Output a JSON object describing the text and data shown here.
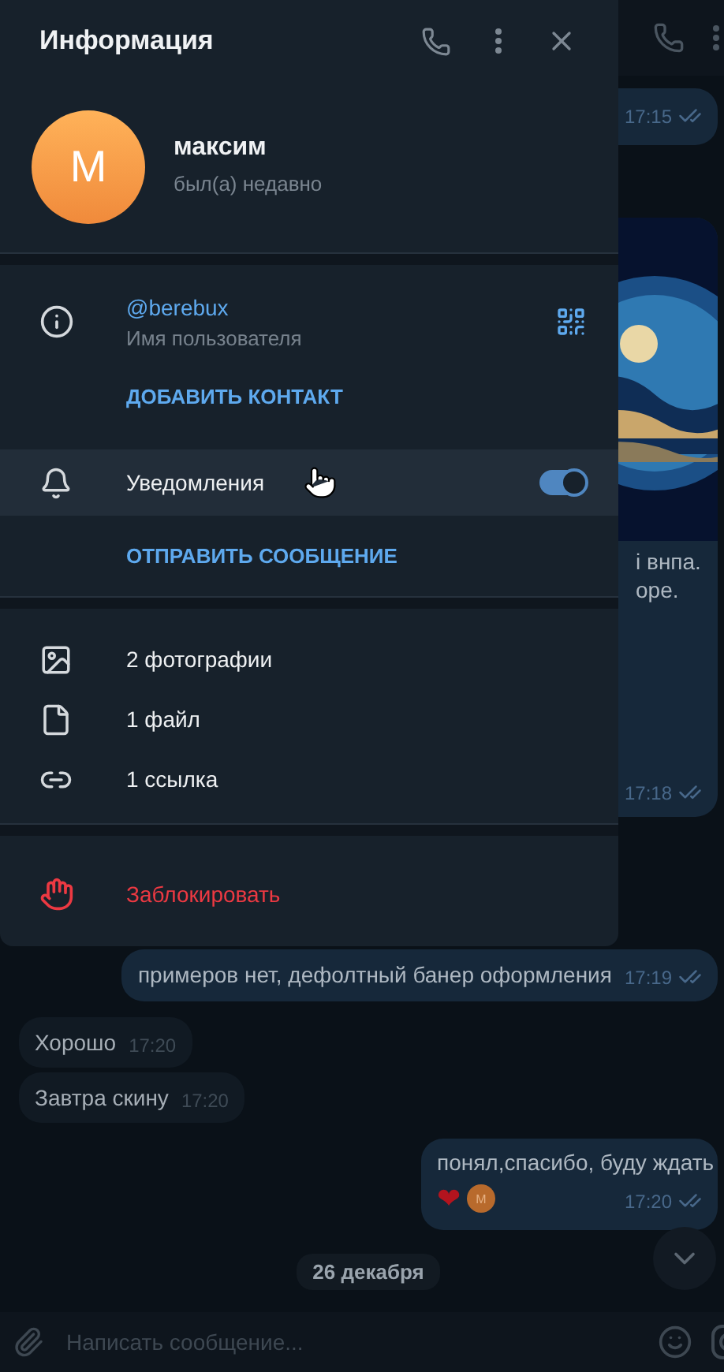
{
  "chat": {
    "messages": [
      {
        "outgoing": true,
        "kind": "text",
        "time": "17:15",
        "read": true
      },
      {
        "outgoing": true,
        "lines": [
          "і внпа.",
          "оре."
        ],
        "time": "17:18",
        "read": true
      },
      {
        "outgoing": true,
        "kind": "text",
        "text": "примеров нет, дефолтный банер оформления",
        "time": "17:19",
        "read": true
      },
      {
        "outgoing": false,
        "kind": "text",
        "text": "Хорошо",
        "time": "17:20"
      },
      {
        "outgoing": false,
        "kind": "text",
        "text": "Завтра скину",
        "time": "17:20"
      },
      {
        "outgoing": true,
        "kind": "reaction",
        "text": "понял,спасибо, буду ждать",
        "reaction": "❤",
        "reactor_initial": "М",
        "time": "17:20",
        "read": true
      }
    ],
    "date": "26 декабря",
    "composer": {
      "placeholder": "Написать сообщение..."
    }
  },
  "panel": {
    "title": "Информация",
    "profile": {
      "initial": "М",
      "name": "максим",
      "status": "был(а) недавно"
    },
    "username": {
      "value": "@berebux",
      "label": "Имя пользователя"
    },
    "add_contact": "ДОБАВИТЬ КОНТАКТ",
    "notifications": {
      "label": "Уведомления",
      "on": true
    },
    "send_message": "ОТПРАВИТЬ СООБЩЕНИЕ",
    "media": [
      {
        "kind": "photos",
        "label": "2 фотографии"
      },
      {
        "kind": "files",
        "label": "1 файл"
      },
      {
        "kind": "links",
        "label": "1 ссылка"
      }
    ],
    "block": "Заблокировать"
  }
}
